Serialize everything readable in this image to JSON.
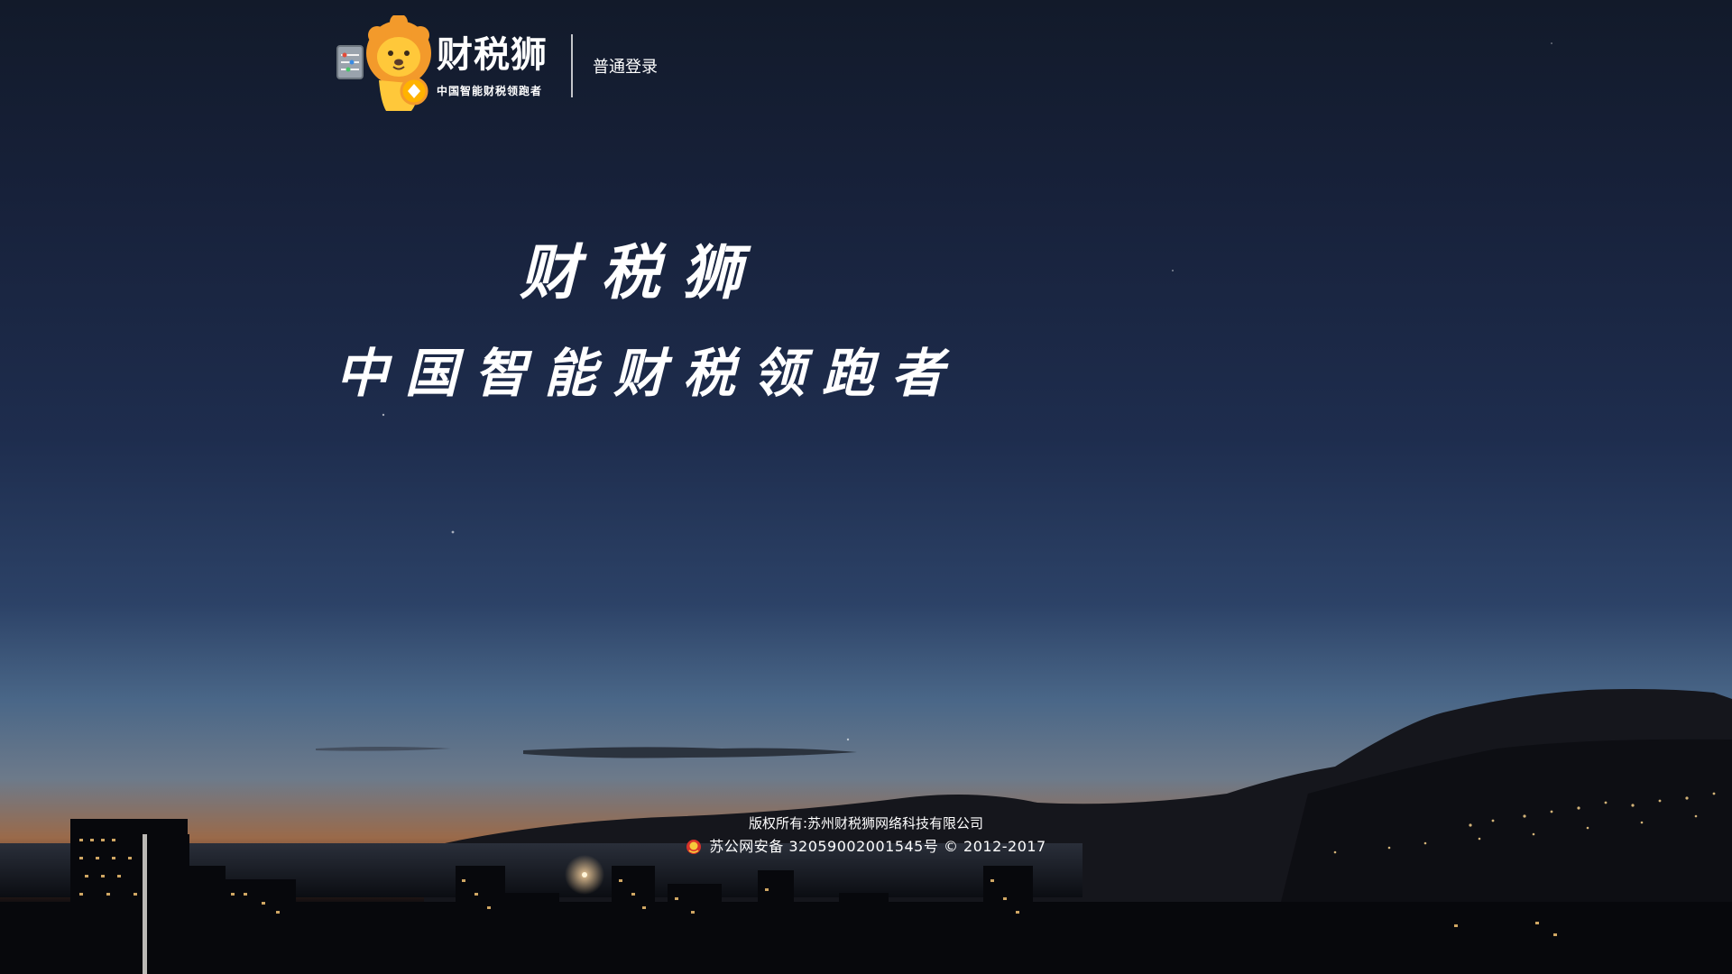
{
  "header": {
    "brand_name": "财税狮",
    "brand_slogan": "中国智能财税领跑者",
    "login_link": "普通登录",
    "logo_icon": "lion-mascot-icon"
  },
  "hero": {
    "title": "财税狮",
    "subtitle": "中国智能财税领跑者"
  },
  "footer": {
    "copyright": "版权所有:苏州财税狮网络科技有限公司",
    "record": "苏公网安备 32059002001545号 © 2012-2017",
    "record_icon": "police-badge-icon"
  },
  "colors": {
    "text": "#ffffff",
    "sky_top": "#121a2a",
    "sky_mid": "#2c4267",
    "horizon_glow": "#9a6a4a",
    "lion_orange": "#f39a2b",
    "lion_yellow": "#ffc83a"
  }
}
